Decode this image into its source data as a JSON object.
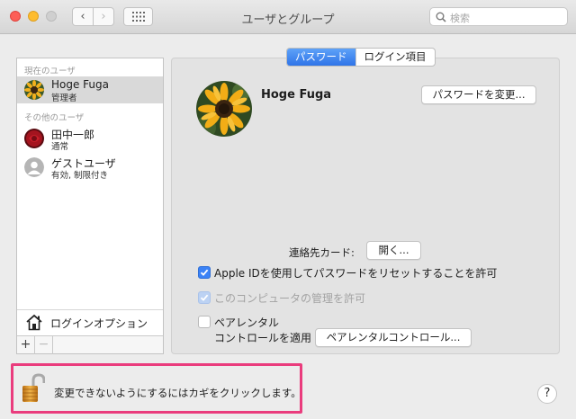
{
  "window": {
    "title": "ユーザとグループ",
    "search_placeholder": "検索"
  },
  "sidebar": {
    "current_users_label": "現在のユーザ",
    "other_users_label": "その他のユーザ",
    "current_user": {
      "name": "Hoge Fuga",
      "role": "管理者",
      "selected": true
    },
    "other_users": [
      {
        "name": "田中一郎",
        "role": "通常"
      },
      {
        "name": "ゲストユーザ",
        "role": "有効, 制限付き"
      }
    ],
    "login_options_label": "ログインオプション",
    "add_label": "+",
    "remove_label": "−"
  },
  "tabs": [
    {
      "label": "パスワード",
      "active": true
    },
    {
      "label": "ログイン項目",
      "active": false
    }
  ],
  "main": {
    "user_name": "Hoge Fuga",
    "change_password_label": "パスワードを変更...",
    "contact_card_label": "連絡先カード:",
    "open_label": "開く...",
    "apple_id_reset": {
      "label": "Apple IDを使用してパスワードをリセットすることを許可",
      "checked": true
    },
    "allow_admin": {
      "label": "このコンピュータの管理を許可",
      "checked": true,
      "disabled": true
    },
    "parental": {
      "label_line1": "ペアレンタル",
      "label_line2": "コントロールを適用",
      "checked": false
    },
    "parental_button_label": "ペアレンタルコントロール..."
  },
  "footer": {
    "lock_text": "変更できないようにするにはカギをクリックします。",
    "help_label": "?"
  },
  "colors": {
    "accent": "#3b82f6",
    "highlight_border": "#ea3c7d"
  }
}
